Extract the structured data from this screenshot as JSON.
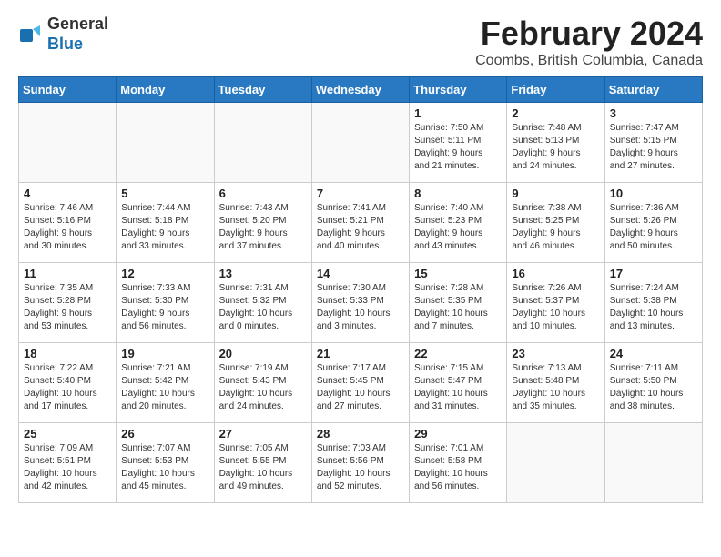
{
  "header": {
    "logo_line1": "General",
    "logo_line2": "Blue",
    "month_year": "February 2024",
    "location": "Coombs, British Columbia, Canada"
  },
  "weekdays": [
    "Sunday",
    "Monday",
    "Tuesday",
    "Wednesday",
    "Thursday",
    "Friday",
    "Saturday"
  ],
  "weeks": [
    [
      {
        "day": "",
        "info": ""
      },
      {
        "day": "",
        "info": ""
      },
      {
        "day": "",
        "info": ""
      },
      {
        "day": "",
        "info": ""
      },
      {
        "day": "1",
        "info": "Sunrise: 7:50 AM\nSunset: 5:11 PM\nDaylight: 9 hours\nand 21 minutes."
      },
      {
        "day": "2",
        "info": "Sunrise: 7:48 AM\nSunset: 5:13 PM\nDaylight: 9 hours\nand 24 minutes."
      },
      {
        "day": "3",
        "info": "Sunrise: 7:47 AM\nSunset: 5:15 PM\nDaylight: 9 hours\nand 27 minutes."
      }
    ],
    [
      {
        "day": "4",
        "info": "Sunrise: 7:46 AM\nSunset: 5:16 PM\nDaylight: 9 hours\nand 30 minutes."
      },
      {
        "day": "5",
        "info": "Sunrise: 7:44 AM\nSunset: 5:18 PM\nDaylight: 9 hours\nand 33 minutes."
      },
      {
        "day": "6",
        "info": "Sunrise: 7:43 AM\nSunset: 5:20 PM\nDaylight: 9 hours\nand 37 minutes."
      },
      {
        "day": "7",
        "info": "Sunrise: 7:41 AM\nSunset: 5:21 PM\nDaylight: 9 hours\nand 40 minutes."
      },
      {
        "day": "8",
        "info": "Sunrise: 7:40 AM\nSunset: 5:23 PM\nDaylight: 9 hours\nand 43 minutes."
      },
      {
        "day": "9",
        "info": "Sunrise: 7:38 AM\nSunset: 5:25 PM\nDaylight: 9 hours\nand 46 minutes."
      },
      {
        "day": "10",
        "info": "Sunrise: 7:36 AM\nSunset: 5:26 PM\nDaylight: 9 hours\nand 50 minutes."
      }
    ],
    [
      {
        "day": "11",
        "info": "Sunrise: 7:35 AM\nSunset: 5:28 PM\nDaylight: 9 hours\nand 53 minutes."
      },
      {
        "day": "12",
        "info": "Sunrise: 7:33 AM\nSunset: 5:30 PM\nDaylight: 9 hours\nand 56 minutes."
      },
      {
        "day": "13",
        "info": "Sunrise: 7:31 AM\nSunset: 5:32 PM\nDaylight: 10 hours\nand 0 minutes."
      },
      {
        "day": "14",
        "info": "Sunrise: 7:30 AM\nSunset: 5:33 PM\nDaylight: 10 hours\nand 3 minutes."
      },
      {
        "day": "15",
        "info": "Sunrise: 7:28 AM\nSunset: 5:35 PM\nDaylight: 10 hours\nand 7 minutes."
      },
      {
        "day": "16",
        "info": "Sunrise: 7:26 AM\nSunset: 5:37 PM\nDaylight: 10 hours\nand 10 minutes."
      },
      {
        "day": "17",
        "info": "Sunrise: 7:24 AM\nSunset: 5:38 PM\nDaylight: 10 hours\nand 13 minutes."
      }
    ],
    [
      {
        "day": "18",
        "info": "Sunrise: 7:22 AM\nSunset: 5:40 PM\nDaylight: 10 hours\nand 17 minutes."
      },
      {
        "day": "19",
        "info": "Sunrise: 7:21 AM\nSunset: 5:42 PM\nDaylight: 10 hours\nand 20 minutes."
      },
      {
        "day": "20",
        "info": "Sunrise: 7:19 AM\nSunset: 5:43 PM\nDaylight: 10 hours\nand 24 minutes."
      },
      {
        "day": "21",
        "info": "Sunrise: 7:17 AM\nSunset: 5:45 PM\nDaylight: 10 hours\nand 27 minutes."
      },
      {
        "day": "22",
        "info": "Sunrise: 7:15 AM\nSunset: 5:47 PM\nDaylight: 10 hours\nand 31 minutes."
      },
      {
        "day": "23",
        "info": "Sunrise: 7:13 AM\nSunset: 5:48 PM\nDaylight: 10 hours\nand 35 minutes."
      },
      {
        "day": "24",
        "info": "Sunrise: 7:11 AM\nSunset: 5:50 PM\nDaylight: 10 hours\nand 38 minutes."
      }
    ],
    [
      {
        "day": "25",
        "info": "Sunrise: 7:09 AM\nSunset: 5:51 PM\nDaylight: 10 hours\nand 42 minutes."
      },
      {
        "day": "26",
        "info": "Sunrise: 7:07 AM\nSunset: 5:53 PM\nDaylight: 10 hours\nand 45 minutes."
      },
      {
        "day": "27",
        "info": "Sunrise: 7:05 AM\nSunset: 5:55 PM\nDaylight: 10 hours\nand 49 minutes."
      },
      {
        "day": "28",
        "info": "Sunrise: 7:03 AM\nSunset: 5:56 PM\nDaylight: 10 hours\nand 52 minutes."
      },
      {
        "day": "29",
        "info": "Sunrise: 7:01 AM\nSunset: 5:58 PM\nDaylight: 10 hours\nand 56 minutes."
      },
      {
        "day": "",
        "info": ""
      },
      {
        "day": "",
        "info": ""
      }
    ]
  ]
}
